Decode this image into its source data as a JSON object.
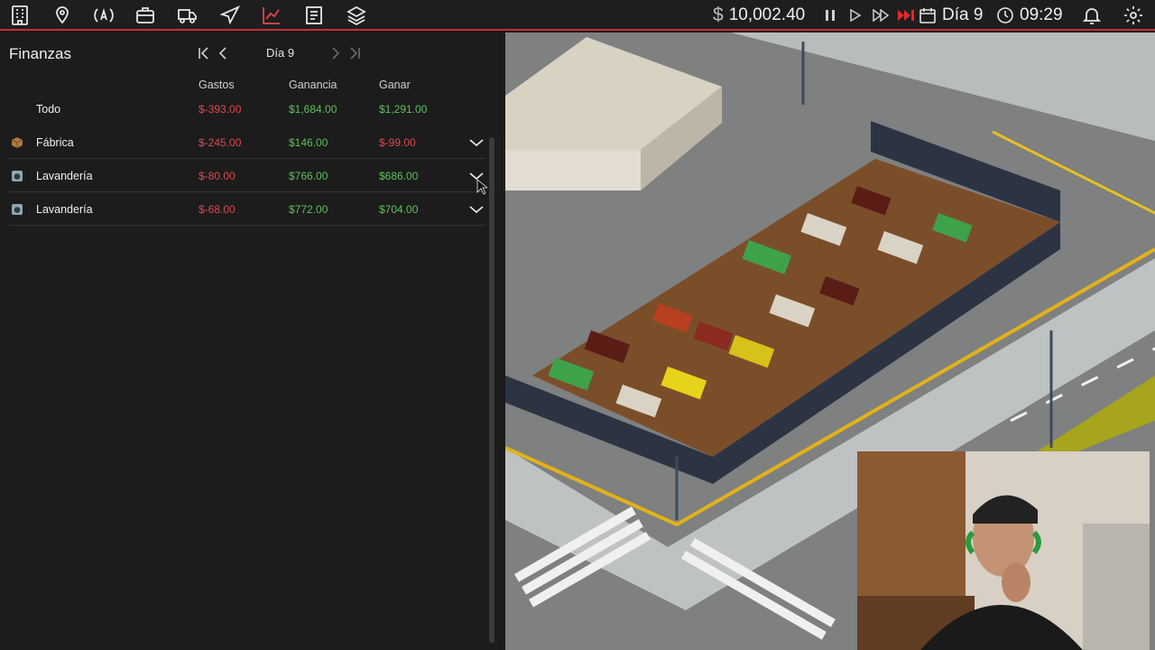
{
  "topbar": {
    "icons": [
      "building-icon",
      "settings-pin-icon",
      "broadcast-icon",
      "briefcase-icon",
      "truck-icon",
      "airplane-icon",
      "chart-icon",
      "document-icon",
      "layers-icon"
    ],
    "money": "10,002.40",
    "day": "Día 9",
    "time": "09:29",
    "accent": "#c62f33"
  },
  "finance": {
    "title": "Finanzas",
    "day_label": "Día 9",
    "columns": {
      "expenses": "Gastos",
      "income": "Ganancia",
      "profit": "Ganar"
    },
    "total": {
      "label": "Todo",
      "expenses": "$-393.00",
      "income": "$1,684.00",
      "profit": "$1,291.00"
    },
    "rows": [
      {
        "label": "Fábrica",
        "icon": "factory-box-icon",
        "expenses": "$-245.00",
        "income": "$146.00",
        "profit": "$-99.00"
      },
      {
        "label": "Lavandería",
        "icon": "laundry-icon",
        "expenses": "$-80.00",
        "income": "$766.00",
        "profit": "$686.00"
      },
      {
        "label": "Lavandería",
        "icon": "laundry-icon",
        "expenses": "$-68.00",
        "income": "$772.00",
        "profit": "$704.00"
      }
    ],
    "colors": {
      "negative": "#e0474c",
      "positive": "#5cc05a"
    }
  }
}
